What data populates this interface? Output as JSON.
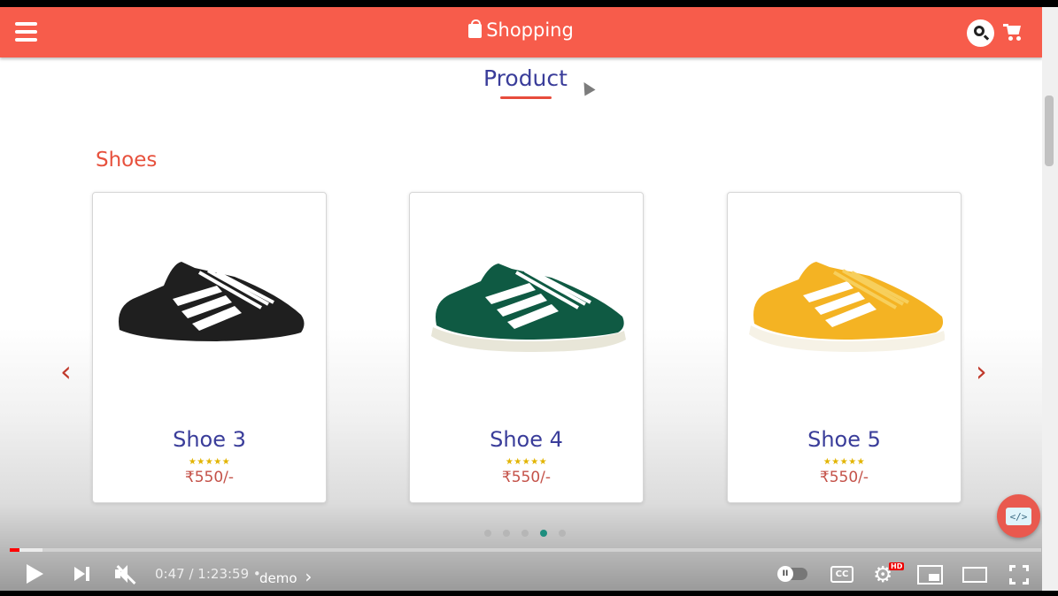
{
  "app": {
    "brand": "Shopping",
    "section_title": "Product",
    "category": "Shoes"
  },
  "products": [
    {
      "name": "Shoe 3",
      "stars": "★★★★★",
      "price": "₹550/-",
      "colors": {
        "upper": "#1f1f1f",
        "stripe": "#ffffff",
        "sole": "#ffffff"
      }
    },
    {
      "name": "Shoe 4",
      "stars": "★★★★★",
      "price": "₹550/-",
      "colors": {
        "upper": "#0f5a43",
        "stripe": "#ffffff",
        "sole": "#e8e6d8"
      }
    },
    {
      "name": "Shoe 5",
      "stars": "★★★★★",
      "price": "₹550/-",
      "colors": {
        "upper": "#f4b323",
        "stripe": "#ffffff",
        "sole": "#f6f2e6"
      }
    }
  ],
  "carousel": {
    "prev_label": "‹",
    "next_label": "›",
    "dots": 5,
    "active_dot": 4
  },
  "fab": {
    "label": "</>"
  },
  "player": {
    "current_time": "0:47",
    "duration": "1:23:59",
    "separator": "•",
    "chapter": "demo",
    "chapter_chevron": "›",
    "progress_played": 0.0093,
    "progress_buffered": 0.032,
    "cc_label": "CC",
    "hd_badge": "HD",
    "autoplay_state": "paused"
  },
  "colors": {
    "navbar": "#f75c4b",
    "title": "#3a3d9a",
    "accent": "#e74c3c",
    "active_dot": "#1e8e7e",
    "progress": "#ff0000"
  }
}
